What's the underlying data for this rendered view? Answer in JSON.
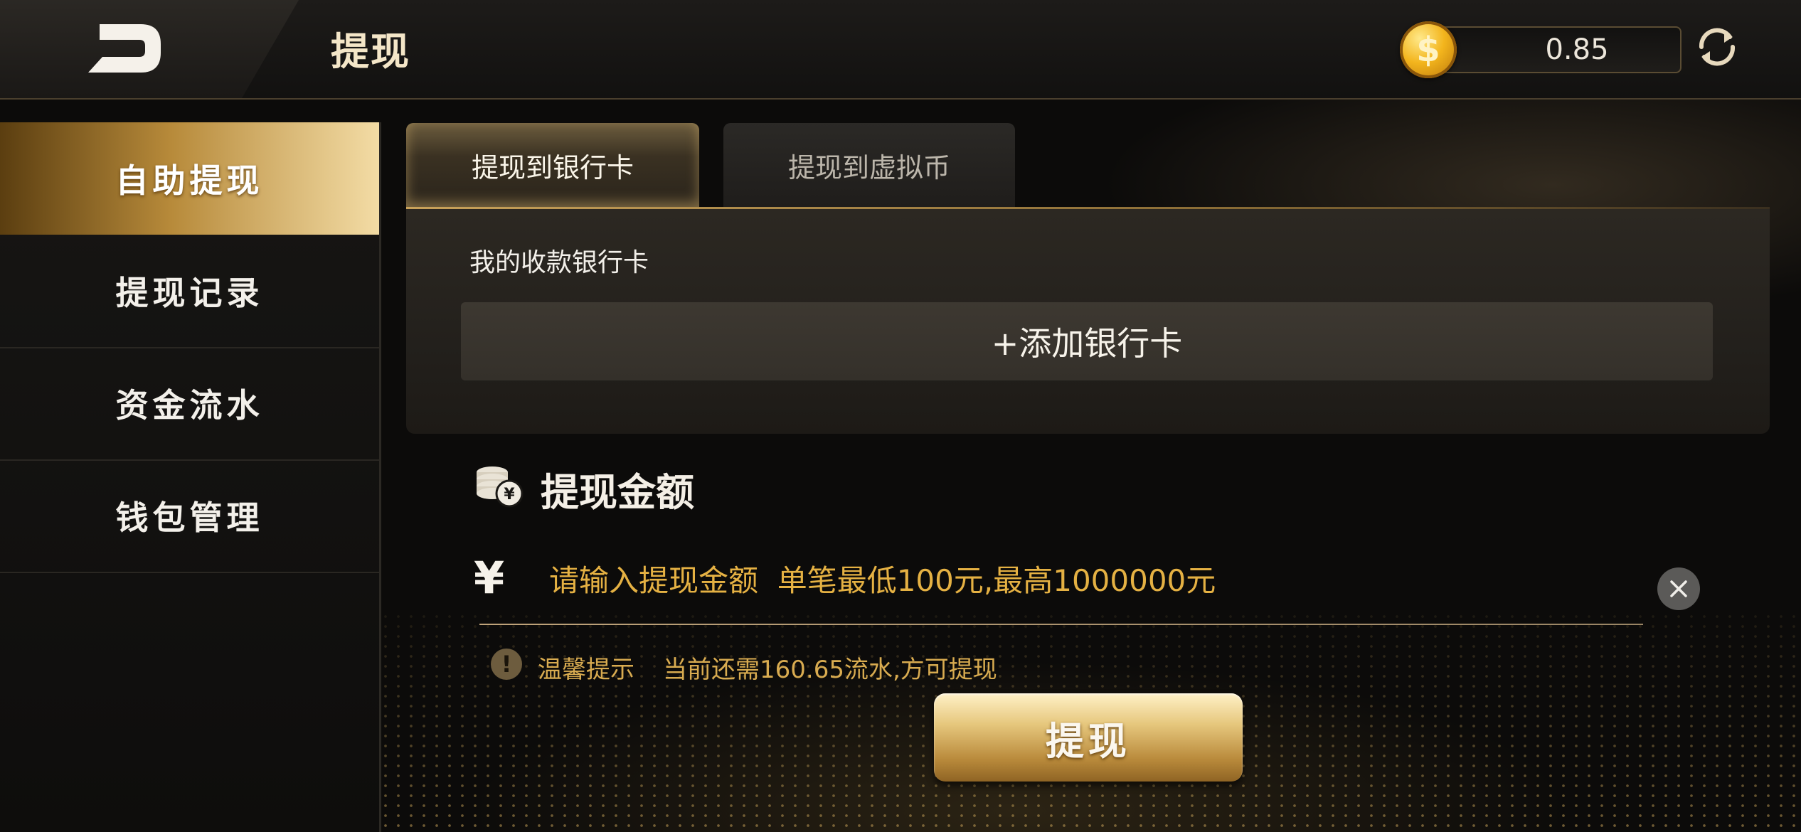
{
  "header": {
    "title": "提现",
    "balance": "0.85",
    "coin_symbol": "$"
  },
  "sidebar": {
    "items": [
      {
        "label": "自助提现",
        "active": true
      },
      {
        "label": "提现记录",
        "active": false
      },
      {
        "label": "资金流水",
        "active": false
      },
      {
        "label": "钱包管理",
        "active": false
      }
    ]
  },
  "tabs": [
    {
      "label": "提现到银行卡",
      "active": true
    },
    {
      "label": "提现到虚拟币",
      "active": false
    }
  ],
  "bank_card": {
    "label": "我的收款银行卡",
    "add_button": "+添加银行卡"
  },
  "amount": {
    "title": "提现金额",
    "currency_symbol": "¥",
    "placeholder": "请输入提现金额  单笔最低100元,最高1000000元"
  },
  "tip": {
    "icon_text": "!",
    "label": "温馨提示",
    "text": "当前还需160.65流水,方可提现"
  },
  "submit_button": "提现",
  "colors": {
    "accent_gold": "#e5b143",
    "tip_gold": "#d8ab50",
    "background": "#0c0b0a"
  }
}
